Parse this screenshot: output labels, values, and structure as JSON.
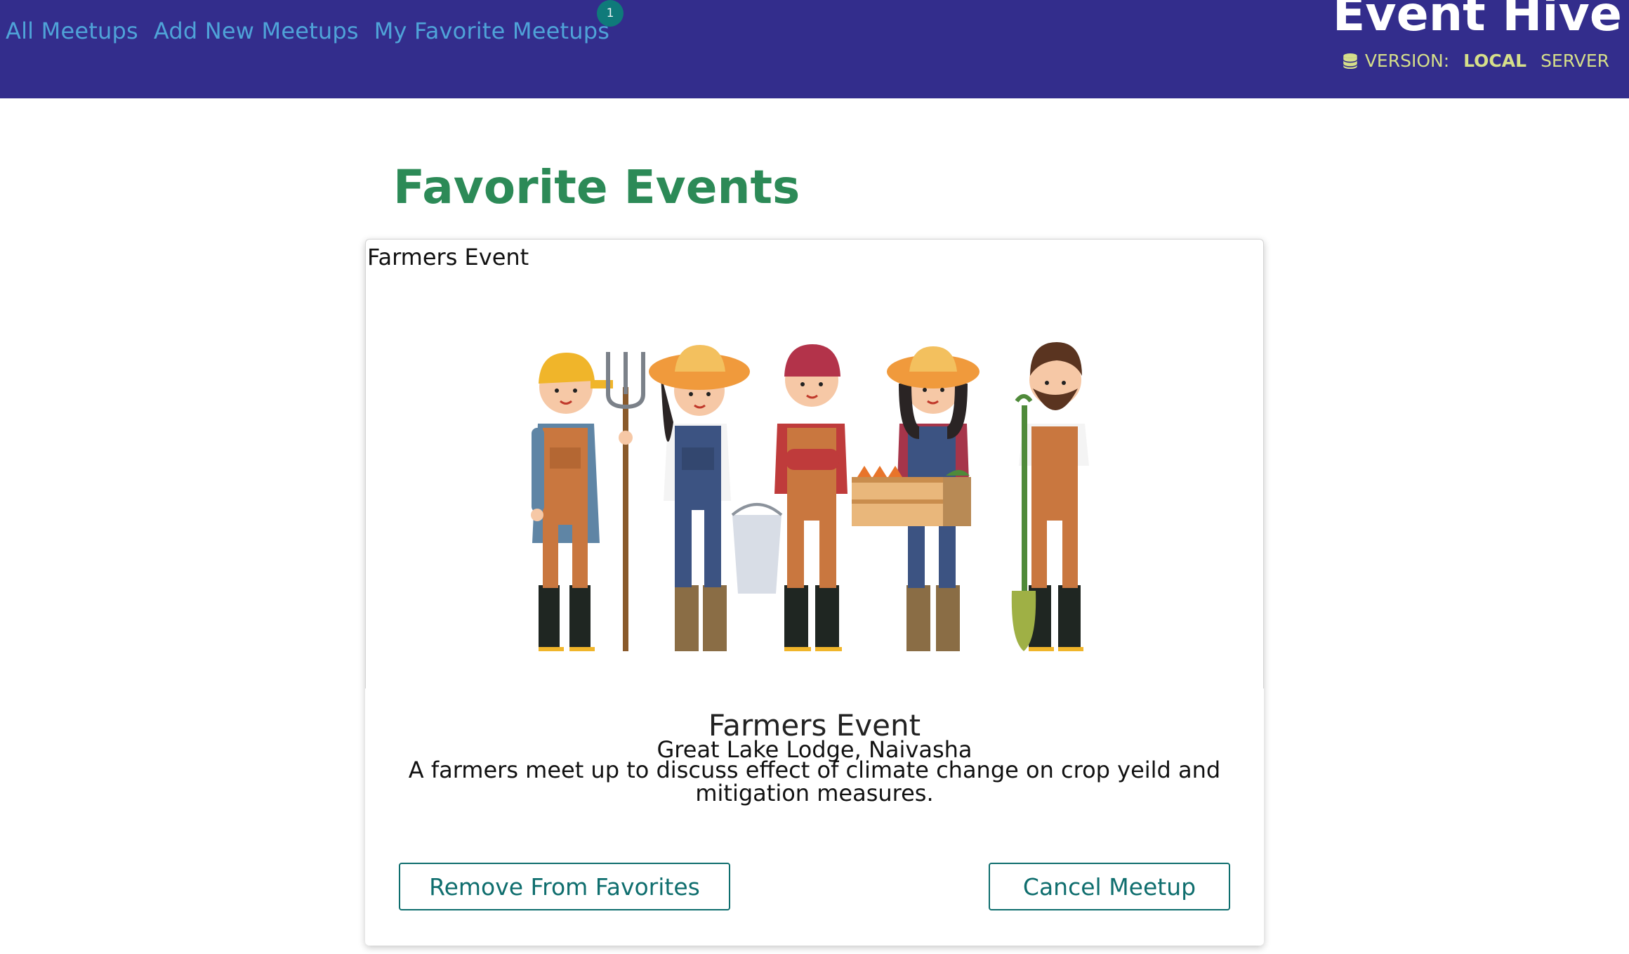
{
  "header": {
    "nav": {
      "all_meetups": "All Meetups",
      "add_new_meetups": "Add New Meetups",
      "my_favorite_meetups": "My Favorite Meetups",
      "favorite_count": "1"
    },
    "brand": "Event Hive",
    "version": {
      "icon": "database-icon",
      "label": "VERSION:",
      "local": "LOCAL",
      "server": "SERVER"
    }
  },
  "main": {
    "page_title": "Favorite Events",
    "events": [
      {
        "image_alt": "Farmers Event",
        "title": "Farmers Event",
        "address": "Great Lake Lodge, Naivasha",
        "description": "A farmers meet up to discuss effect of climate change on crop yeild and mitigation measures.",
        "remove_label": "Remove From Favorites",
        "cancel_label": "Cancel Meetup"
      }
    ]
  },
  "colors": {
    "header_bg": "#332d8c",
    "nav_link": "#4fa3d8",
    "badge": "#0f7a7a",
    "version_text": "#d6df8a",
    "title_green": "#2c8a57",
    "button_teal": "#0f6e6e"
  }
}
